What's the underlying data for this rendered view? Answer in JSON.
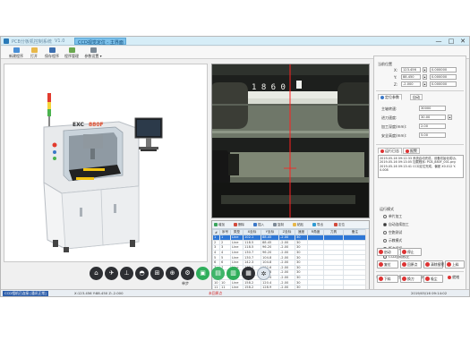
{
  "window": {
    "title_left": "PCB分板机控制系统",
    "title_mid": "V1.0",
    "active_tab": "CCD视觉定位 - 主界面",
    "btn_min": "—",
    "btn_max": "□",
    "btn_close": "✕"
  },
  "toolbar": {
    "items": [
      {
        "label": "新建程序",
        "icon": "new-file-icon"
      },
      {
        "label": "打开",
        "icon": "open-folder-icon"
      },
      {
        "label": "保存程序",
        "icon": "save-icon"
      },
      {
        "label": "程序管理",
        "icon": "manage-icon"
      },
      {
        "label": "参数设置 ▾",
        "icon": "settings-icon"
      }
    ]
  },
  "machine_photo": {
    "brand_prefix": "EXC",
    "brand_model": "880F"
  },
  "grid": {
    "toolbar": [
      "增加",
      "删除",
      "插入",
      "复制",
      "粘贴",
      "导出",
      "定位"
    ],
    "headers": [
      "#",
      "序号",
      "类型",
      "X坐标",
      "Y坐标",
      "Z坐标",
      "速度",
      "R角度",
      "刀具",
      "备注"
    ],
    "rows": [
      {
        "n": "1",
        "c": [
          "1",
          "Line",
          "102.1",
          "88.45",
          "-2.00",
          "30",
          "",
          "",
          ""
        ]
      },
      {
        "n": "2",
        "c": [
          "2",
          "Line",
          "118.5",
          "88.45",
          "-2.00",
          "30",
          "",
          "",
          ""
        ]
      },
      {
        "n": "3",
        "c": [
          "3",
          "Line",
          "118.5",
          "96.20",
          "-2.00",
          "30",
          "",
          "",
          ""
        ]
      },
      {
        "n": "4",
        "c": [
          "4",
          "Line",
          "130.7",
          "96.20",
          "-2.00",
          "30",
          "",
          "",
          ""
        ]
      },
      {
        "n": "5",
        "c": [
          "5",
          "Line",
          "130.7",
          "104.8",
          "-2.00",
          "30",
          "",
          "",
          ""
        ]
      },
      {
        "n": "6",
        "c": [
          "6",
          "Line",
          "142.3",
          "104.8",
          "-2.00",
          "30",
          "",
          "",
          ""
        ]
      },
      {
        "n": "7",
        "c": [
          "7",
          "Line",
          "142.3",
          "112.6",
          "-2.00",
          "30",
          "",
          "",
          ""
        ]
      },
      {
        "n": "8",
        "c": [
          "8",
          "Line",
          "150.9",
          "112.6",
          "-2.00",
          "30",
          "",
          "",
          ""
        ]
      },
      {
        "n": "9",
        "c": [
          "9",
          "Line",
          "150.9",
          "120.4",
          "-2.00",
          "30",
          "",
          "",
          ""
        ]
      },
      {
        "n": "10",
        "c": [
          "10",
          "Line",
          "158.2",
          "120.4",
          "-2.00",
          "30",
          "",
          "",
          ""
        ]
      },
      {
        "n": "11",
        "c": [
          "11",
          "Line",
          "158.2",
          "128.9",
          "-2.00",
          "30",
          "",
          "",
          ""
        ]
      },
      {
        "n": "12",
        "c": [
          "12",
          "Line",
          "164.6",
          "128.9",
          "-2.00",
          "30",
          "",
          "",
          ""
        ]
      },
      {
        "n": "13",
        "c": [
          "13",
          "Line",
          "164.6",
          "136.1",
          "-2.00",
          "30",
          "",
          "",
          ""
        ]
      }
    ]
  },
  "iconbar": {
    "label": "单步",
    "icons": [
      "home-icon",
      "tool-icon",
      "z-axis-icon",
      "spindle-icon",
      "align-icon",
      "grid-icon",
      "measure-icon",
      "green-a-icon",
      "green-b-icon",
      "green-c-icon",
      "table-icon",
      "gear-icon"
    ]
  },
  "right": {
    "top_labels": [
      "当前位置",
      "X:",
      "Y:",
      "Z:"
    ],
    "top_values": [
      "123.456",
      "88.450",
      "-2.000"
    ],
    "top_right_values": [
      "0.000000",
      "0.000000",
      "0.000000"
    ],
    "tab1": "定位参数",
    "tab2": "自动",
    "params": [
      {
        "label": "主轴转速:",
        "value": "30000"
      },
      {
        "label": "进刀速度:",
        "value": "30.00"
      },
      {
        "label": "加工深度(mm):",
        "value": "2.00"
      },
      {
        "label": "安全高度(mm):",
        "value": "5.00"
      }
    ],
    "tab3": "运行日志",
    "tab4": "报警",
    "log_lines": [
      "2019-05-16 09:12:33 系统启动完成，设备初始化成功。",
      "2019-05-16 09:13:05 加载程序: PCB_880F_001.prg",
      "2019-05-16 09:13:41 CCD定位完成，偏差 X0.012 Y-0.008"
    ],
    "mode_title": "运行模式",
    "modes": [
      {
        "label": "单片加工",
        "on": false
      },
      {
        "label": "自动连续加工",
        "on": true
      },
      {
        "label": "空跑测试",
        "on": false
      },
      {
        "label": "示教模式",
        "on": false
      },
      {
        "label": "断点续切",
        "on": false
      },
      {
        "label": "CCD自动校正",
        "on": false
      }
    ],
    "status_row": [
      "状态:",
      "急停",
      "暂停",
      "报警",
      "就绪"
    ],
    "buttons": [
      "启动",
      "停止",
      "复位",
      "回原点",
      "清除报警",
      "上料",
      "下料",
      "换刀",
      "吸尘"
    ]
  },
  "statusbar": {
    "left": "CCD相机已连接 [通讯正常]",
    "mid": "X:123.456 Y:88.450 Z:-2.000",
    "warn": "未回原点",
    "right": "2019/05/16 09:14:02"
  }
}
